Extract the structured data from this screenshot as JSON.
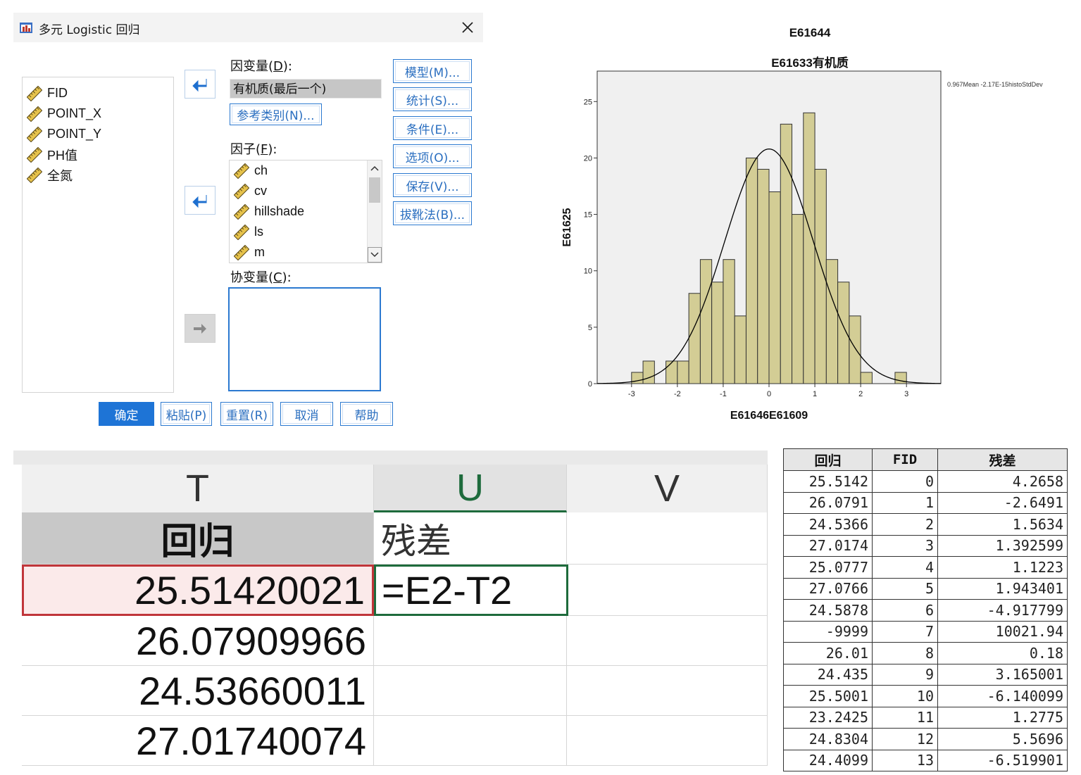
{
  "dialog": {
    "title": "多元 Logistic 回归",
    "variables": [
      "FID",
      "POINT_X",
      "POINT_Y",
      "PH值",
      "全氮"
    ],
    "dependent_label": "因变量(",
    "dependent_key": "D",
    "dependent_suffix": "):",
    "dependent_value": "有机质(最后一个)",
    "reference_category_button": "参考类别(N)...",
    "factor_label": "因子(",
    "factor_key": "F",
    "factor_suffix": "):",
    "factors": [
      "ch",
      "cv",
      "hillshade",
      "ls",
      "m"
    ],
    "covariate_label": "协变量(",
    "covariate_key": "C",
    "covariate_suffix": "):",
    "side_buttons": [
      "模型(M)...",
      "统计(S)...",
      "条件(E)...",
      "选项(O)...",
      "保存(V)...",
      "拔靴法(B)..."
    ],
    "bottom_buttons": [
      "确定",
      "粘贴(P)",
      "重置(R)",
      "取消",
      "帮助"
    ]
  },
  "chart": {
    "title1": "E61644",
    "title2": "E61633有机质",
    "note": "0.967Mean -2.17E-15histoStdDev",
    "ylabel": "E61625",
    "xlabel": "E61646E61609"
  },
  "chart_data": {
    "type": "bar",
    "bin_width": 0.25,
    "bins_start": [
      -3.0,
      -2.75,
      -2.5,
      -2.25,
      -2.0,
      -1.75,
      -1.5,
      -1.25,
      -1.0,
      -0.75,
      -0.5,
      -0.25,
      0.0,
      0.25,
      0.5,
      0.75,
      1.0,
      1.25,
      1.5,
      1.75,
      2.0,
      2.25,
      2.5,
      2.75
    ],
    "values": [
      1,
      2,
      0,
      2,
      2,
      8,
      11,
      9,
      11,
      6,
      20,
      19,
      17,
      23,
      15,
      24,
      19,
      11,
      9,
      6,
      1,
      0,
      0,
      1
    ],
    "normal_curve": {
      "mean": 0,
      "std": 0.967,
      "peak": 20.8
    },
    "xticks": [
      -3,
      -2,
      -1,
      0,
      1,
      2,
      3
    ],
    "yticks": [
      0,
      5,
      10,
      15,
      20,
      25
    ],
    "xlim": [
      -3.75,
      3.75
    ],
    "ylim": [
      0,
      27.7
    ],
    "xlabel": "E61646E61609",
    "ylabel": "E61625",
    "title": "E61633有机质",
    "colors": {
      "bar": "#d3cd95",
      "bar_edge": "#333333",
      "plot_bg": "#f0f0f0",
      "curve": "#000000"
    }
  },
  "sheet": {
    "columns": [
      "T",
      "U",
      "V"
    ],
    "header_row": [
      "回归",
      "残差",
      ""
    ],
    "rows": [
      [
        "25.51420021",
        "=E2-T2",
        ""
      ],
      [
        "26.07909966",
        "",
        ""
      ],
      [
        "24.53660011",
        "",
        ""
      ],
      [
        "27.01740074",
        "",
        ""
      ]
    ]
  },
  "table": {
    "headers": [
      "回归",
      "FID",
      "残差"
    ],
    "rows": [
      [
        "25.5142",
        "0",
        "4.2658"
      ],
      [
        "26.0791",
        "1",
        "-2.6491"
      ],
      [
        "24.5366",
        "2",
        "1.5634"
      ],
      [
        "27.0174",
        "3",
        "1.392599"
      ],
      [
        "25.0777",
        "4",
        "1.1223"
      ],
      [
        "27.0766",
        "5",
        "1.943401"
      ],
      [
        "24.5878",
        "6",
        "-4.917799"
      ],
      [
        "-9999",
        "7",
        "10021.94"
      ],
      [
        "26.01",
        "8",
        "0.18"
      ],
      [
        "24.435",
        "9",
        "3.165001"
      ],
      [
        "25.5001",
        "10",
        "-6.140099"
      ],
      [
        "23.2425",
        "11",
        "1.2775"
      ],
      [
        "24.8304",
        "12",
        "5.5696"
      ],
      [
        "24.4099",
        "13",
        "-6.519901"
      ]
    ]
  },
  "icons": [
    "app-icon",
    "close-icon",
    "ruler-icon",
    "arrow-left-icon",
    "arrow-right-icon",
    "chevron-up-icon",
    "chevron-down-icon"
  ]
}
